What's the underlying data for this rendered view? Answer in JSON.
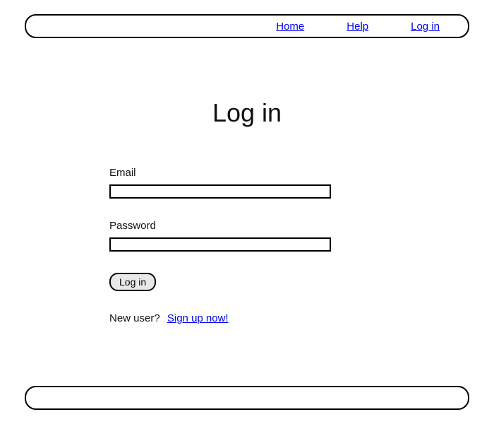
{
  "header": {
    "links": {
      "home": "Home",
      "help": "Help",
      "login": "Log in"
    }
  },
  "main": {
    "title": "Log in",
    "email_label": "Email",
    "password_label": "Password",
    "submit_label": "Log in",
    "new_user_text": "New user?",
    "signup_link": "Sign up now!"
  }
}
